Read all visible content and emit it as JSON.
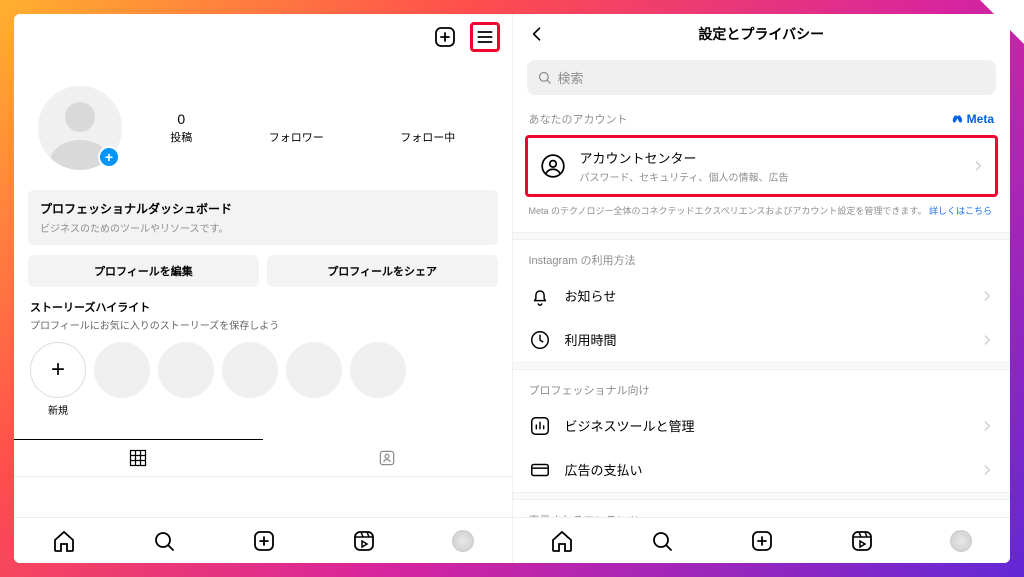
{
  "left": {
    "stats": {
      "posts_num": "0",
      "posts_lbl": "投稿",
      "followers_lbl": "フォロワー",
      "following_lbl": "フォロー中"
    },
    "dashboard": {
      "title": "プロフェッショナルダッシュボード",
      "sub": "ビジネスのためのツールやリソースです。"
    },
    "buttons": {
      "edit": "プロフィールを編集",
      "share": "プロフィールをシェア"
    },
    "highlights": {
      "title": "ストーリーズハイライト",
      "sub": "プロフィールにお気に入りのストーリーズを保存しよう",
      "new_lbl": "新規"
    }
  },
  "right": {
    "header_title": "設定とプライバシー",
    "search_placeholder": "検索",
    "account_section": "あなたのアカウント",
    "meta_brand": "Meta",
    "account_center": {
      "title": "アカウントセンター",
      "sub": "パスワード、セキュリティ、個人の情報、広告"
    },
    "meta_note": "Meta のテクノロジー全体のコネクテッドエクスペリエンスおよびアカウント設定を管理できます。",
    "meta_note_link": "詳しくはこちら",
    "usage_section": "Instagram の利用方法",
    "rows": {
      "notifications": "お知らせ",
      "time": "利用時間",
      "pro_section": "プロフェッショナル向け",
      "biz": "ビジネスツールと管理",
      "ads": "広告の支払い",
      "content_section": "表示されるコンテンツ"
    }
  }
}
